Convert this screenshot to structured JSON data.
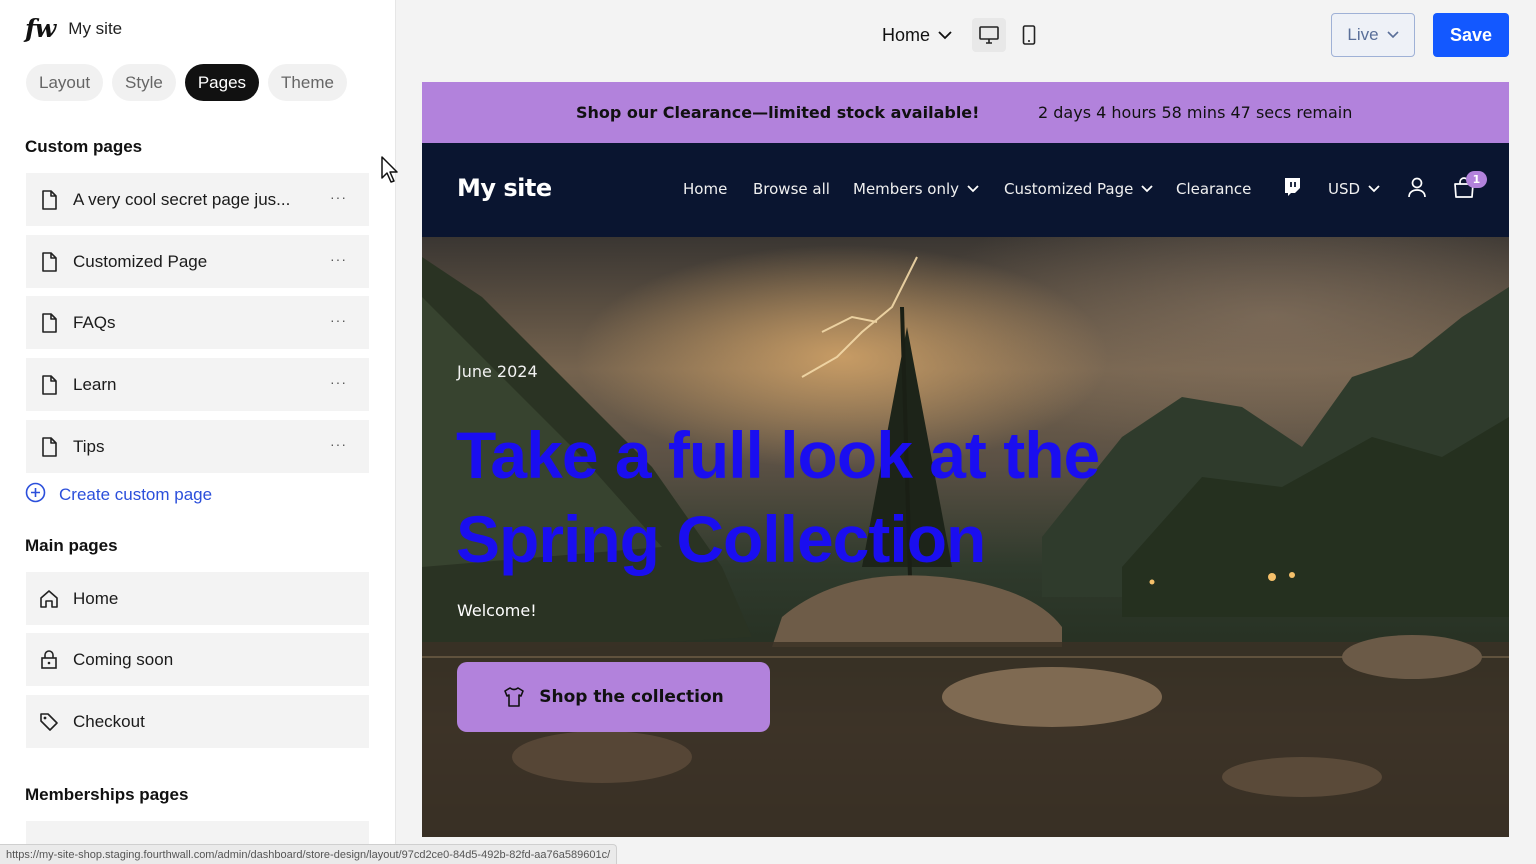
{
  "sidebar": {
    "brand_logo": "fw",
    "brand_name": "My site",
    "tabs": [
      {
        "label": "Layout",
        "active": false
      },
      {
        "label": "Style",
        "active": false
      },
      {
        "label": "Pages",
        "active": true
      },
      {
        "label": "Theme",
        "active": false
      }
    ],
    "custom_pages_title": "Custom pages",
    "custom_pages": [
      {
        "label": "A very cool secret page jus...",
        "icon": "page-icon"
      },
      {
        "label": "Customized Page",
        "icon": "page-icon"
      },
      {
        "label": "FAQs",
        "icon": "page-icon"
      },
      {
        "label": "Learn",
        "icon": "page-icon"
      },
      {
        "label": "Tips",
        "icon": "page-icon"
      }
    ],
    "more_label": "···",
    "create_label": "Create custom page",
    "main_pages_title": "Main pages",
    "main_pages": [
      {
        "label": "Home",
        "icon": "home-icon"
      },
      {
        "label": "Coming soon",
        "icon": "lock-icon"
      },
      {
        "label": "Checkout",
        "icon": "tag-icon"
      }
    ],
    "memberships_title": "Memberships pages"
  },
  "topbar": {
    "page_select": "Home",
    "live_label": "Live",
    "save_label": "Save"
  },
  "preview": {
    "announcement": "Shop our Clearance—limited stock available!",
    "countdown": "2 days 4 hours 58 mins 47 secs remain",
    "site_title": "My site",
    "nav": [
      "Home",
      "Browse all",
      "Members only",
      "Customized Page",
      "Clearance"
    ],
    "currency": "USD",
    "cart_count": "1",
    "hero": {
      "date": "June 2024",
      "title": "Take a full look at the Spring Collection",
      "subtitle": "Welcome!",
      "button": "Shop the collection"
    }
  },
  "status_url": "https://my-site-shop.staging.fourthwall.com/admin/dashboard/store-design/layout/97cd2ce0-84d5-492b-82fd-aa76a589601c/",
  "colors": {
    "accent_purple": "#b282dc",
    "save_blue": "#1358ff",
    "hero_title_blue": "#1a0ef0",
    "nav_bg": "#0a1530"
  }
}
